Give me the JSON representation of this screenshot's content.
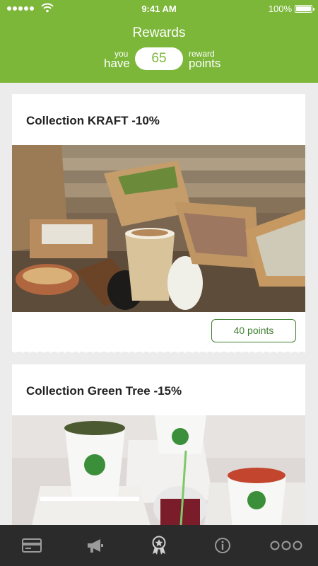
{
  "status_bar": {
    "time": "9:41 AM",
    "battery": "100%"
  },
  "header": {
    "title": "Rewards",
    "you_small": "you",
    "you_big": "have",
    "points_value": "65",
    "reward_small": "reward",
    "reward_big": "points"
  },
  "rewards": [
    {
      "title": "Collection KRAFT -10%",
      "points_label": "40 points",
      "image": "kraft-packaging-photo"
    },
    {
      "title": "Collection Green Tree -15%",
      "image": "green-tree-packaging-photo"
    }
  ],
  "nav": [
    {
      "icon": "card-icon",
      "name": "nav-card"
    },
    {
      "icon": "megaphone-icon",
      "name": "nav-news"
    },
    {
      "icon": "award-icon",
      "name": "nav-rewards"
    },
    {
      "icon": "info-icon",
      "name": "nav-info"
    },
    {
      "icon": "more-icon",
      "name": "nav-more"
    }
  ],
  "colors": {
    "brand_green": "#7cb73a",
    "button_green": "#3f7f2f",
    "nav_bg": "#2b2b2b"
  }
}
